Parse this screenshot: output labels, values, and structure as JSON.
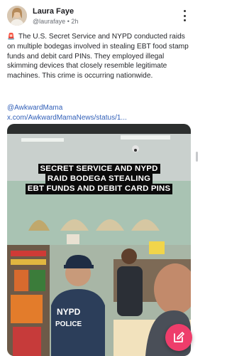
{
  "author": {
    "name": "Laura Faye",
    "handle": "@laurafaye",
    "separator": "•",
    "time": "2h"
  },
  "post": {
    "siren_glyph": "🚨",
    "text": "The U.S. Secret Service and NYPD conducted raids on multiple bodegas involved in stealing EBT food stamp funds and debit card PINs. They employed illegal skimming devices that closely resemble legitimate machines. This crime is occurring nationwide.",
    "mention": "@AwkwardMama",
    "link": "x.com/AwkwardMamaNews/status/1..."
  },
  "media": {
    "caption_lines": [
      "SECRET SERVICE AND NYPD",
      "RAID BODEGA STEALING",
      "EBT FUNDS AND DEBIT CARD PINS"
    ],
    "vest_text": [
      "NYPD",
      "POLICE"
    ]
  },
  "fab": {
    "icon": "compose-icon",
    "color": "#ee3d6b"
  },
  "colors": {
    "link": "#3260b8",
    "siren": "#d8262b"
  }
}
